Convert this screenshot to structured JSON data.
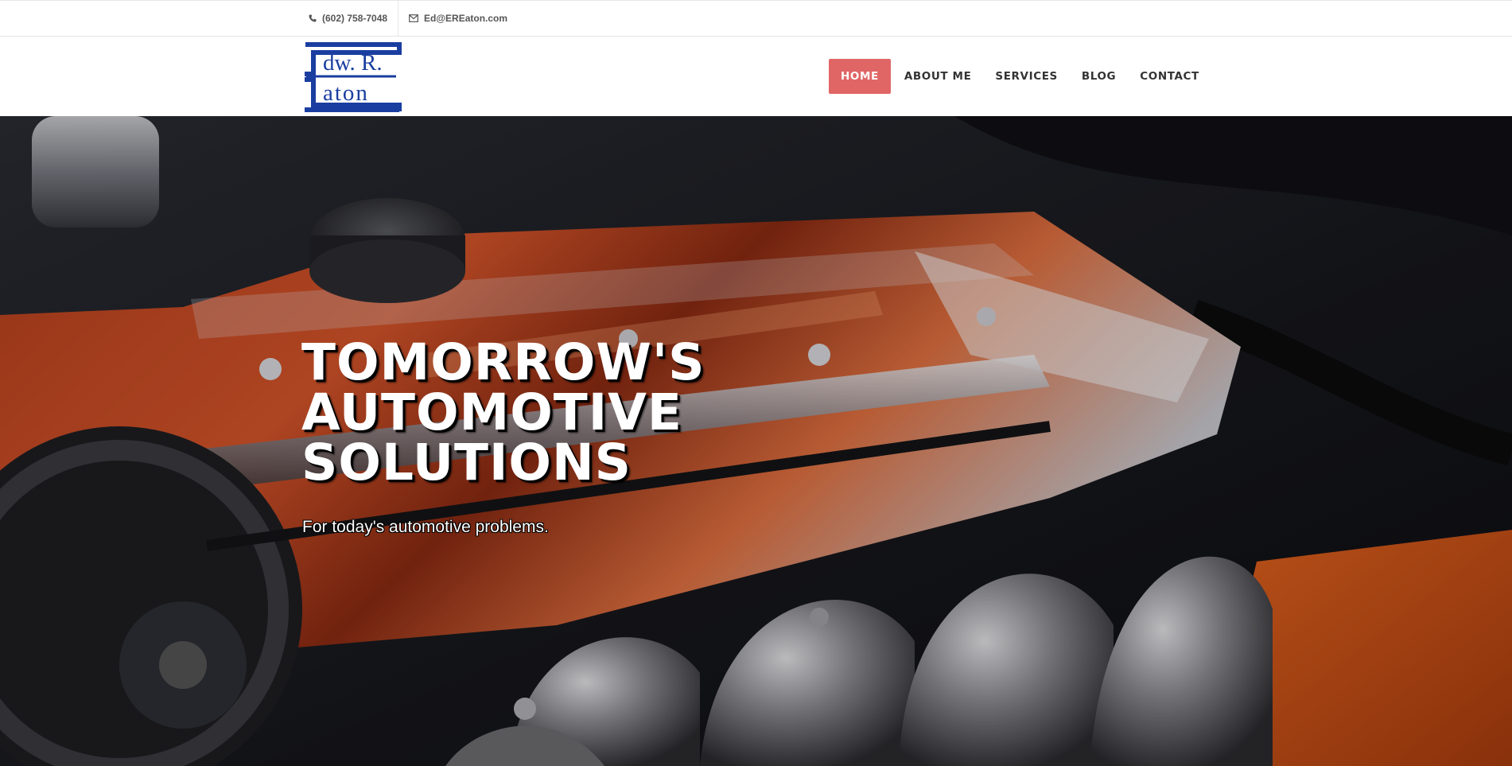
{
  "topbar": {
    "phone": "(602) 758-7048",
    "email": "Ed@EREaton.com",
    "phone_icon": "phone-icon",
    "email_icon": "envelope-icon"
  },
  "logo": {
    "line1": "dw. R.",
    "line2": "aton",
    "color": "#1a3ea0"
  },
  "nav": {
    "items": [
      {
        "label": "HOME",
        "active": true
      },
      {
        "label": "ABOUT ME",
        "active": false
      },
      {
        "label": "SERVICES",
        "active": false
      },
      {
        "label": "BLOG",
        "active": false
      },
      {
        "label": "CONTACT",
        "active": false
      }
    ],
    "active_color": "#e06666"
  },
  "hero": {
    "title_lines": [
      "TOMORROW'S",
      "AUTOMOTIVE",
      "SOLUTIONS"
    ],
    "subtitle": "For today's automotive problems.",
    "image": "car-engine-photo"
  }
}
